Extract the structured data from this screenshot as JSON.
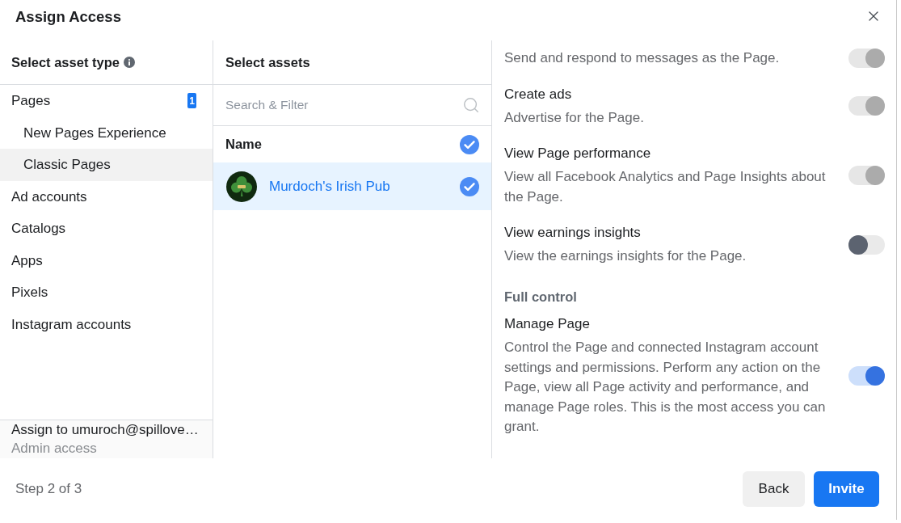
{
  "dialog": {
    "title": "Assign Access"
  },
  "asset_types": {
    "heading": "Select asset type",
    "items": [
      {
        "label": "Pages",
        "badge": "1",
        "selected": false,
        "children": [
          {
            "label": "New Pages Experience",
            "selected": false
          },
          {
            "label": "Classic Pages",
            "selected": true
          }
        ]
      },
      {
        "label": "Ad accounts",
        "selected": false
      },
      {
        "label": "Catalogs",
        "selected": false
      },
      {
        "label": "Apps",
        "selected": false
      },
      {
        "label": "Pixels",
        "selected": false
      },
      {
        "label": "Instagram accounts",
        "selected": false
      }
    ]
  },
  "assignee": {
    "line": "Assign to umuroch@spillove…",
    "role": "Admin access"
  },
  "assets": {
    "heading": "Select assets",
    "search": {
      "placeholder": "Search & Filter"
    },
    "column": {
      "label": "Name",
      "checked": true
    },
    "rows": [
      {
        "name": "Murdoch's Irish Pub",
        "selected": true
      }
    ]
  },
  "permissions": [
    {
      "kind": "toggle",
      "description": "Send and respond to messages as the Page.",
      "on": true,
      "disabled": true
    },
    {
      "kind": "toggle",
      "title": "Create ads",
      "description": "Advertise for the Page.",
      "on": true,
      "disabled": true
    },
    {
      "kind": "toggle",
      "title": "View Page performance",
      "description": "View all Facebook Analytics and Page Insights about the Page.",
      "on": true,
      "disabled": true
    },
    {
      "kind": "toggle",
      "title": "View earnings insights",
      "description": "View the earnings insights for the Page.",
      "on": false,
      "disabled": false
    },
    {
      "kind": "heading",
      "title": "Full control"
    },
    {
      "kind": "toggle",
      "title": "Manage Page",
      "description": "Control the Page and connected Instagram account settings and permissions. Perform any action on the Page, view all Page activity and performance, and manage Page roles. This is the most access you can grant.",
      "on": true,
      "disabled": false
    }
  ],
  "footer": {
    "step": "Step 2 of 3",
    "buttons": [
      {
        "label": "Back",
        "kind": "secondary"
      },
      {
        "label": "Invite",
        "kind": "primary"
      }
    ]
  }
}
